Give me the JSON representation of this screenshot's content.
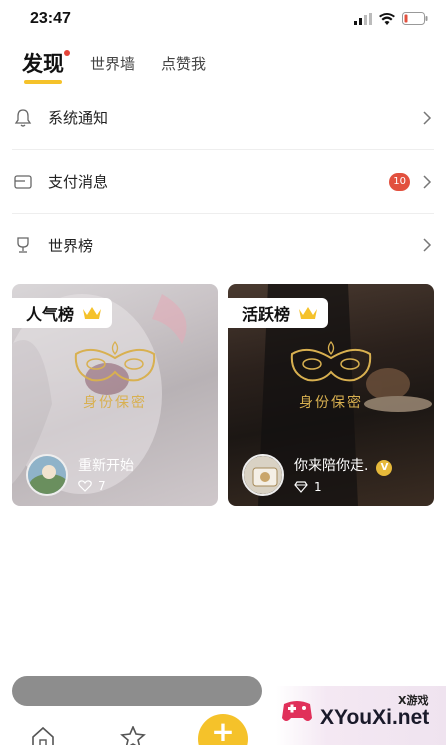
{
  "status_bar": {
    "time": "23:47",
    "icons": [
      "signal-icon",
      "wifi-icon",
      "battery-icon"
    ]
  },
  "tabs": [
    {
      "label": "发现",
      "active": true,
      "has_dot": true
    },
    {
      "label": "世界墙",
      "active": false
    },
    {
      "label": "点赞我",
      "active": false
    }
  ],
  "menu": [
    {
      "label": "系统通知",
      "icon": "bell-icon"
    },
    {
      "label": "支付消息",
      "icon": "wallet-icon",
      "badge": "10"
    },
    {
      "label": "世界榜",
      "icon": "trophy-icon"
    }
  ],
  "cards": [
    {
      "tag": "人气榜",
      "mask_text": "身份保密",
      "user_name": "重新开始",
      "stat_icon": "heart-icon",
      "stat_value": "7"
    },
    {
      "tag": "活跃榜",
      "mask_text": "身份保密",
      "user_name": "你来陪你走.",
      "stat_icon": "diamond-icon",
      "stat_value": "1",
      "vip": true
    }
  ],
  "bottom_nav": {
    "items": [
      "home-icon",
      "star-icon",
      "add-icon",
      "profile-icon"
    ],
    "fab_label": "+"
  },
  "watermark": {
    "sub": "X游戏",
    "text": "XYouXi.net"
  },
  "colors": {
    "accent": "#f5c22a",
    "badge": "#e2503e",
    "gold": "#d8b050"
  }
}
